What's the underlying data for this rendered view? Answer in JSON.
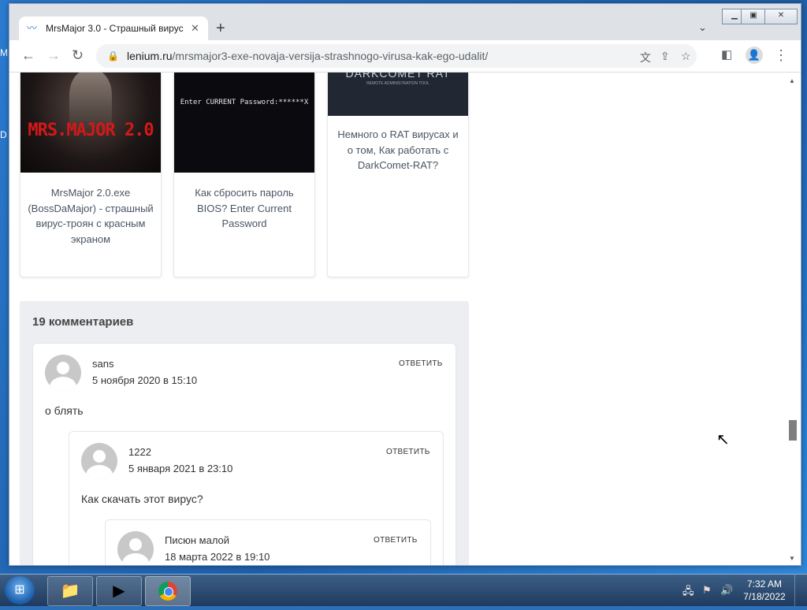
{
  "desktop": {
    "letters": [
      "M",
      "D"
    ]
  },
  "browser": {
    "tab_title": "MrsMajor 3.0 - Страшный вирус",
    "tab_close": "✕",
    "new_tab": "+",
    "tab_dropdown": "⌄",
    "window_controls": {
      "minimize": "▁",
      "maximize": "▣",
      "close": "✕"
    },
    "url_host": "lenium.ru",
    "url_path": "/mrsmajor3-exe-novaja-versija-strashnogo-virusa-kak-ego-udalit/"
  },
  "related": [
    {
      "title": "MrsMajor 2.0.exe (BossDaMajor) - страшный вирус-троян с красным экраном",
      "image_text": "MRS.MAJOR 2.0"
    },
    {
      "title": "Как сбросить пароль BIOS? Enter Current Password",
      "image_text": "Enter CURRENT Password:******X"
    },
    {
      "title": "Немного о RAT вирусах и о том, Как работать с DarkComet-RAT?",
      "image_text": "DARKCOMET RAT",
      "image_subtext": "REMOTE ADMINISTRATION TOOL"
    }
  ],
  "comments": {
    "title": "19 комментариев",
    "items": [
      {
        "author": "sans",
        "date": "5 ноября 2020 в 15:10",
        "text": "о блять",
        "reply": "ОТВЕТИТЬ"
      },
      {
        "author": "1222",
        "date": "5 января 2021 в 23:10",
        "text": "Как скачать этот вирус?",
        "reply": "ОТВЕТИТЬ"
      },
      {
        "author": "Писюн малой",
        "date": "18 марта 2022 в 19:10",
        "text": "",
        "reply": "ОТВЕТИТЬ"
      }
    ]
  },
  "taskbar": {
    "time": "7:32 AM",
    "date": "7/18/2022"
  },
  "colors": {
    "accent_chrome": "#dee1e6",
    "comments_bg": "#eceef1",
    "taskbar": "#2b4a70"
  }
}
